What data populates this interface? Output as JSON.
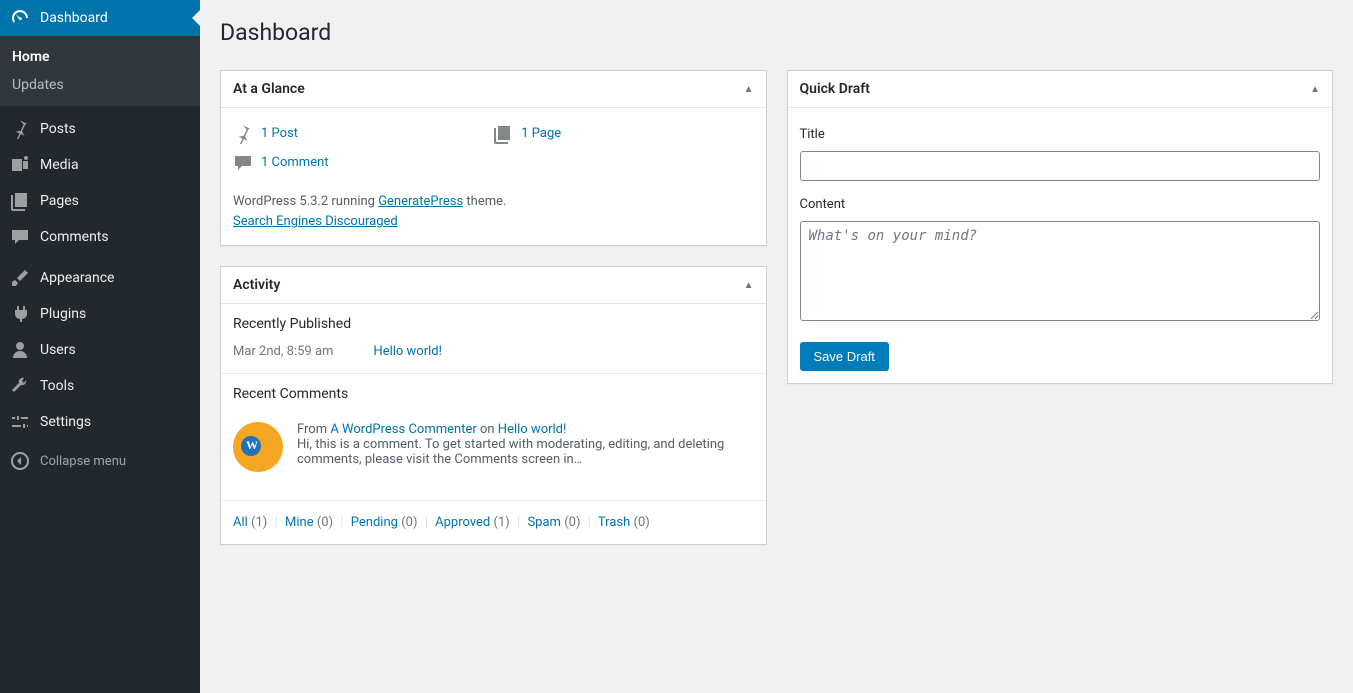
{
  "page_title": "Dashboard",
  "sidebar": {
    "items": [
      {
        "label": "Dashboard",
        "icon": "dashboard",
        "current": true
      },
      {
        "label": "Posts",
        "icon": "pin"
      },
      {
        "label": "Media",
        "icon": "media"
      },
      {
        "label": "Pages",
        "icon": "page"
      },
      {
        "label": "Comments",
        "icon": "comment"
      },
      {
        "label": "Appearance",
        "icon": "brush"
      },
      {
        "label": "Plugins",
        "icon": "plug"
      },
      {
        "label": "Users",
        "icon": "user"
      },
      {
        "label": "Tools",
        "icon": "wrench"
      },
      {
        "label": "Settings",
        "icon": "sliders"
      }
    ],
    "submenu": [
      {
        "label": "Home",
        "current": true
      },
      {
        "label": "Updates"
      }
    ],
    "collapse_label": "Collapse menu"
  },
  "glance": {
    "title": "At a Glance",
    "posts": "1 Post",
    "pages": "1 Page",
    "comments": "1 Comment",
    "version_prefix": "WordPress 5.3.2 running ",
    "theme_name": "GeneratePress",
    "version_suffix": " theme.",
    "search_engines": "Search Engines Discouraged"
  },
  "activity": {
    "title": "Activity",
    "recently_published_title": "Recently Published",
    "recent_date": "Mar 2nd, 8:59 am",
    "recent_post": "Hello world!",
    "recent_comments_title": "Recent Comments",
    "comment_from_prefix": "From ",
    "comment_author": "A WordPress Commenter",
    "comment_on": " on ",
    "comment_post": "Hello world!",
    "comment_excerpt": "Hi, this is a comment. To get started with moderating, editing, and deleting comments, please visit the Comments screen in…",
    "filters": {
      "all": "All",
      "all_count": "(1)",
      "mine": "Mine",
      "mine_count": "(0)",
      "pending": "Pending",
      "pending_count": "(0)",
      "approved": "Approved",
      "approved_count": "(1)",
      "spam": "Spam",
      "spam_count": "(0)",
      "trash": "Trash",
      "trash_count": "(0)"
    }
  },
  "quickdraft": {
    "title": "Quick Draft",
    "title_label": "Title",
    "content_label": "Content",
    "content_placeholder": "What's on your mind?",
    "save_label": "Save Draft"
  }
}
